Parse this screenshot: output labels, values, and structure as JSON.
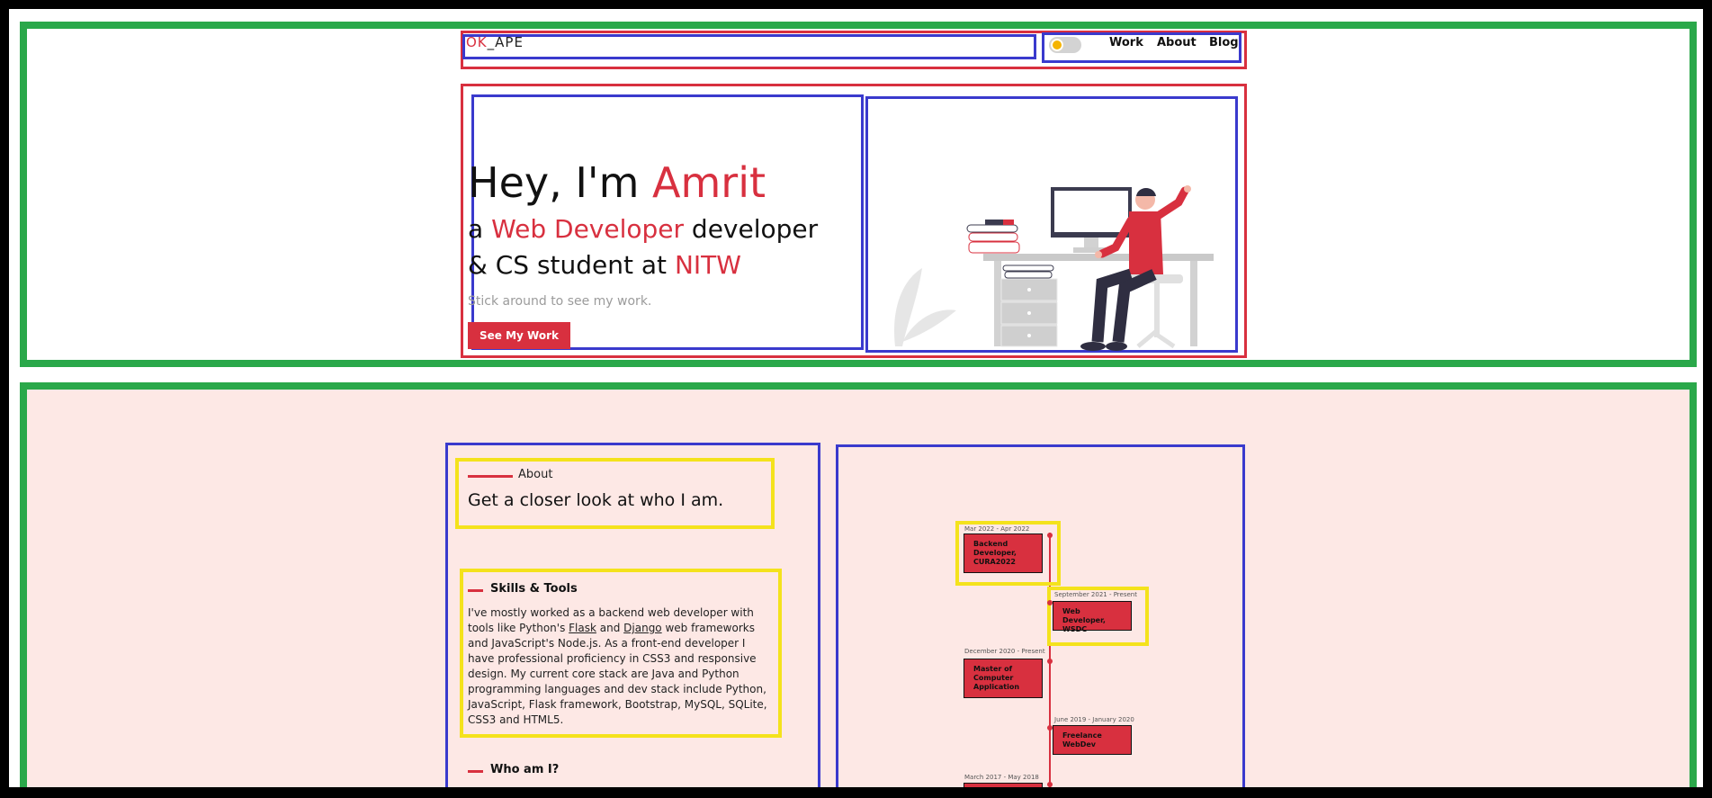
{
  "header": {
    "logo_part1": "OK",
    "logo_part2": "_APE",
    "nav": [
      "Work",
      "About",
      "Blog"
    ]
  },
  "hero": {
    "greeting": "Hey, I'm ",
    "name": "Amrit",
    "line2_prefix": "a ",
    "line2_accent": "Web Developer",
    "line2_suffix": " developer",
    "line3_prefix": "& CS student at ",
    "line3_accent": "NITW",
    "subtitle": "Stick around to see my work.",
    "button": "See My Work"
  },
  "about": {
    "label": "About",
    "title": "Get a closer look at who I am.",
    "skills_title": "Skills & Tools",
    "skills_text_1": "I've mostly worked as a backend web developer with tools like Python's ",
    "skills_link_1": "Flask",
    "skills_text_2": " and ",
    "skills_link_2": "Django",
    "skills_text_3": " web frameworks and JavaScript's Node.js. As a front-end developer I have professional proficiency in CSS3 and responsive design. My current core stack are Java and Python programming languages and dev stack include Python, JavaScript, Flask framework, Bootstrap, MySQL, SQLite, CSS3 and HTML5.",
    "who_title": "Who am I?"
  },
  "timeline": [
    {
      "date": "Mar 2022 - Apr 2022",
      "title": "Backend Developer, CURA2022"
    },
    {
      "date": "September 2021 - Present",
      "title": "Web Developer, WSDC"
    },
    {
      "date": "December 2020 - Present",
      "title": "Master of Computer Application"
    },
    {
      "date": "June 2019 - January 2020",
      "title": "Freelance WebDev"
    },
    {
      "date": "March 2017 - May 2018",
      "title": ""
    }
  ],
  "colors": {
    "accent": "#d8303f",
    "section_bg": "#fde8e5",
    "overlay_green": "#2aa84a",
    "overlay_red": "#d8303f",
    "overlay_blue": "#3a3acd",
    "overlay_yellow": "#f4e21c"
  }
}
